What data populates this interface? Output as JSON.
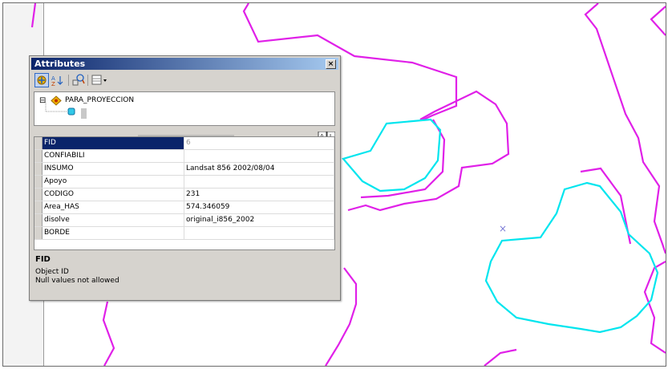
{
  "window": {
    "title": "Attributes",
    "close_glyph": "×"
  },
  "toolbar": {
    "buttons": [
      "list-by-layer-icon",
      "sort-icon",
      "options-icon",
      "table-options-icon"
    ]
  },
  "tree": {
    "expander": "⊟",
    "layer_name": "PARA_PROYECCION"
  },
  "grid": {
    "rows": [
      {
        "field": "FID",
        "value": "6"
      },
      {
        "field": "CONFIABILI",
        "value": ""
      },
      {
        "field": "INSUMO",
        "value": "Landsat 856 2002/08/04"
      },
      {
        "field": "Apoyo",
        "value": ""
      },
      {
        "field": "CODIGO",
        "value": "231"
      },
      {
        "field": "Area_HAS",
        "value": "574.346059"
      },
      {
        "field": "disolve",
        "value": "original_i856_2002"
      },
      {
        "field": "BORDE",
        "value": ""
      }
    ]
  },
  "description": {
    "title": "FID",
    "line1": "Object ID",
    "line2": "Null values not allowed"
  },
  "map": {
    "polygon_color": "#e020e8",
    "selection_color": "#00e5ee",
    "cursor_glyph": "×"
  }
}
